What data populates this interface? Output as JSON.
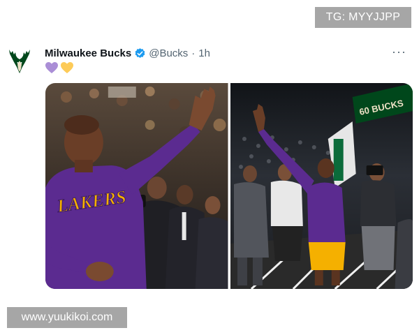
{
  "watermarks": {
    "top": "TG: MYYJJPP",
    "bottom": "www.yuukikoi.com"
  },
  "tweet": {
    "author_name": "Milwaukee Bucks",
    "handle": "@Bucks",
    "separator": "·",
    "time": "1h",
    "verified": true,
    "emoji": [
      "purple-heart-icon",
      "yellow-heart-icon"
    ],
    "more_label": "···",
    "media": {
      "photo1": {
        "jersey_text": "LAKERS"
      },
      "photo2": {
        "banner_text": "60 BUCKS"
      }
    }
  },
  "colors": {
    "bucks_green": "#00471b",
    "lakers_purple": "#5b2b90",
    "lakers_gold": "#f5b000",
    "verified_blue": "#1d9bf0",
    "watermark_gray": "#a6a6a6"
  }
}
